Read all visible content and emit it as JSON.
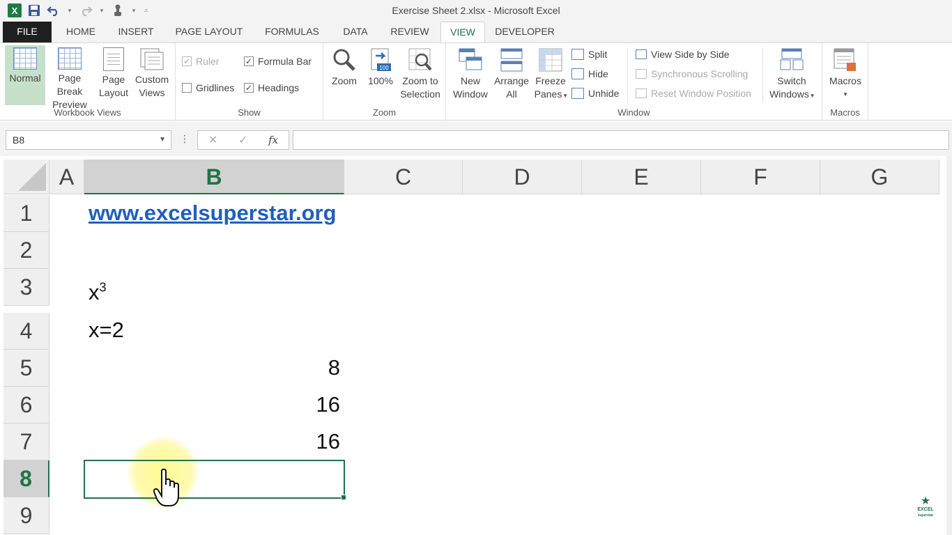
{
  "window": {
    "title": "Exercise Sheet 2.xlsx - Microsoft Excel"
  },
  "qat": {
    "logo": "X"
  },
  "tabs": [
    "FILE",
    "HOME",
    "INSERT",
    "PAGE LAYOUT",
    "FORMULAS",
    "DATA",
    "REVIEW",
    "VIEW",
    "DEVELOPER"
  ],
  "ribbon": {
    "workbook_views": {
      "label": "Workbook Views",
      "normal": "Normal",
      "page_break_1": "Page Break",
      "page_break_2": "Preview",
      "page_layout_1": "Page",
      "page_layout_2": "Layout",
      "custom_1": "Custom",
      "custom_2": "Views"
    },
    "show": {
      "label": "Show",
      "ruler": "Ruler",
      "formula_bar": "Formula Bar",
      "gridlines": "Gridlines",
      "headings": "Headings"
    },
    "zoom": {
      "label": "Zoom",
      "zoom": "Zoom",
      "hundred": "100%",
      "hundred_badge": "100",
      "zoom_sel_1": "Zoom to",
      "zoom_sel_2": "Selection"
    },
    "window": {
      "label": "Window",
      "new_1": "New",
      "new_2": "Window",
      "arrange_1": "Arrange",
      "arrange_2": "All",
      "freeze_1": "Freeze",
      "freeze_2": "Panes",
      "split": "Split",
      "hide": "Hide",
      "unhide": "Unhide",
      "side_by_side": "View Side by Side",
      "sync_scroll": "Synchronous Scrolling",
      "reset_pos": "Reset Window Position",
      "switch_1": "Switch",
      "switch_2": "Windows"
    },
    "macros": {
      "label": "Macros",
      "macros": "Macros"
    }
  },
  "formula_bar": {
    "name_box": "B8",
    "formula": "",
    "fx": "fx"
  },
  "columns": [
    "A",
    "B",
    "C",
    "D",
    "E",
    "F",
    "G"
  ],
  "rows": [
    "1",
    "2",
    "3",
    "4",
    "5",
    "6",
    "7",
    "8",
    "9"
  ],
  "cells": {
    "B1": "www.excelsuperstar.org",
    "B3_base": "x",
    "B3_exp": "3",
    "B4": "x=2",
    "B5": "8",
    "B6": "16",
    "B7": "16"
  },
  "watermark": {
    "line1": "EXCEL",
    "line2": "superstar"
  },
  "colors": {
    "accent": "#217346",
    "link": "#1f5fbf",
    "selected_view": "#c6e0c9"
  }
}
